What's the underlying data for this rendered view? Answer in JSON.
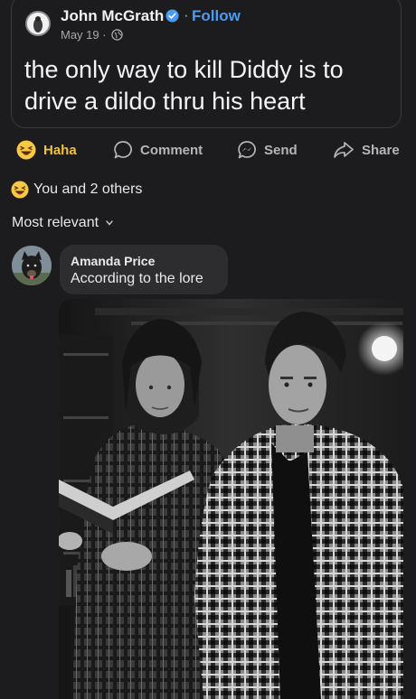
{
  "post": {
    "author": "John McGrath",
    "separator": "·",
    "follow_label": "Follow",
    "date": "May 19 ·",
    "text": "the only way to kill Diddy is to drive a dildo thru his heart"
  },
  "actions": {
    "haha": "Haha",
    "comment": "Comment",
    "send": "Send",
    "share": "Share"
  },
  "reactions": {
    "summary": "You and 2 others"
  },
  "comments_sort": {
    "label": "Most relevant"
  },
  "comment": {
    "author": "Amanda Price",
    "text": "According to the lore"
  },
  "colors": {
    "background": "#1c1c1e",
    "accent_blue": "#4a9bf5",
    "haha_yellow": "#f0c23b",
    "bubble": "#2d2d30"
  },
  "icons": [
    "verified-badge-icon",
    "globe-icon",
    "haha-emoji-icon",
    "comment-icon",
    "messenger-send-icon",
    "share-icon",
    "chevron-down-icon"
  ]
}
